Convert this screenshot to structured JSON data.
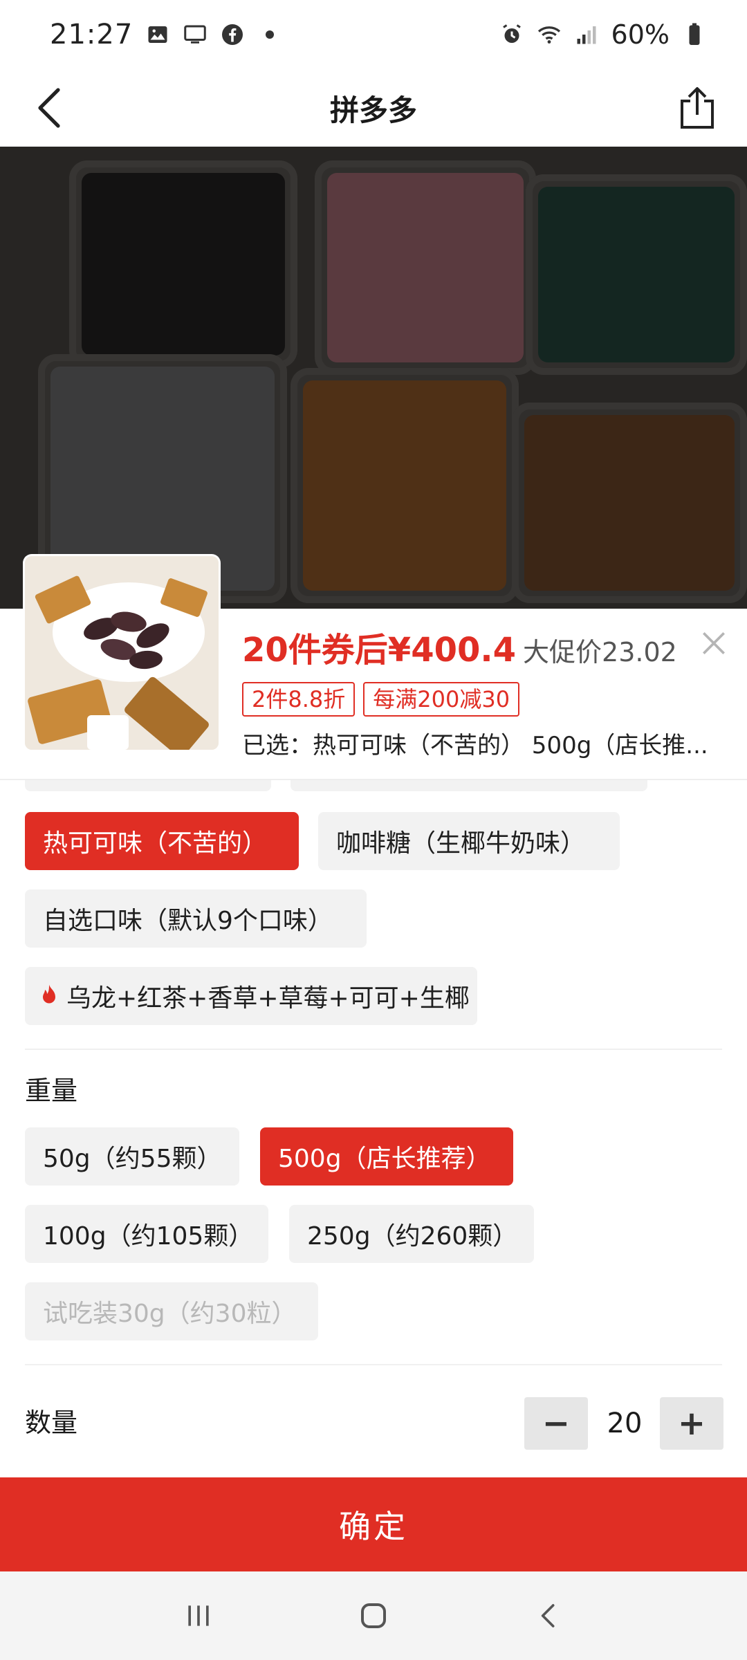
{
  "status_bar": {
    "time": "21:27",
    "battery": "60%",
    "left_icons": [
      "image-icon",
      "screen-icon",
      "facebook-icon",
      "dot-icon"
    ],
    "right_icons": [
      "alarm-icon",
      "wifi-icon",
      "signal-icon",
      "battery-icon"
    ]
  },
  "nav": {
    "title": "拼多多",
    "back_icon": "chevron-left-icon",
    "share_icon": "share-icon"
  },
  "product": {
    "price_label": "20件券后¥400.4",
    "promo_price": "大促价23.02",
    "tags": [
      "2件8.8折",
      "每满200减30"
    ],
    "selected_text": "已选：热可可味（不苦的） 500g（店长推..."
  },
  "flavors": [
    {
      "label": "热可可味（不苦的）",
      "selected": true
    },
    {
      "label": "咖啡糖（生椰牛奶味）",
      "selected": false
    },
    {
      "label": "自选口味（默认9个口味）",
      "selected": false
    },
    {
      "label": "乌龙+红茶+香草+草莓+可可+生椰",
      "selected": false,
      "icon": "fire-icon"
    }
  ],
  "weight": {
    "title": "重量",
    "options": [
      {
        "label": "50g（约55颗）",
        "selected": false
      },
      {
        "label": "500g（店长推荐）",
        "selected": true
      },
      {
        "label": "100g（约105颗）",
        "selected": false
      },
      {
        "label": "250g（约260颗）",
        "selected": false
      },
      {
        "label": "试吃装30g（约30粒）",
        "selected": false,
        "disabled": true
      }
    ]
  },
  "quantity": {
    "label": "数量",
    "value": "20",
    "minus": "−",
    "plus": "+"
  },
  "confirm_label": "确定",
  "colors": {
    "accent": "#e02e24",
    "chip_bg": "#f2f2f2"
  }
}
